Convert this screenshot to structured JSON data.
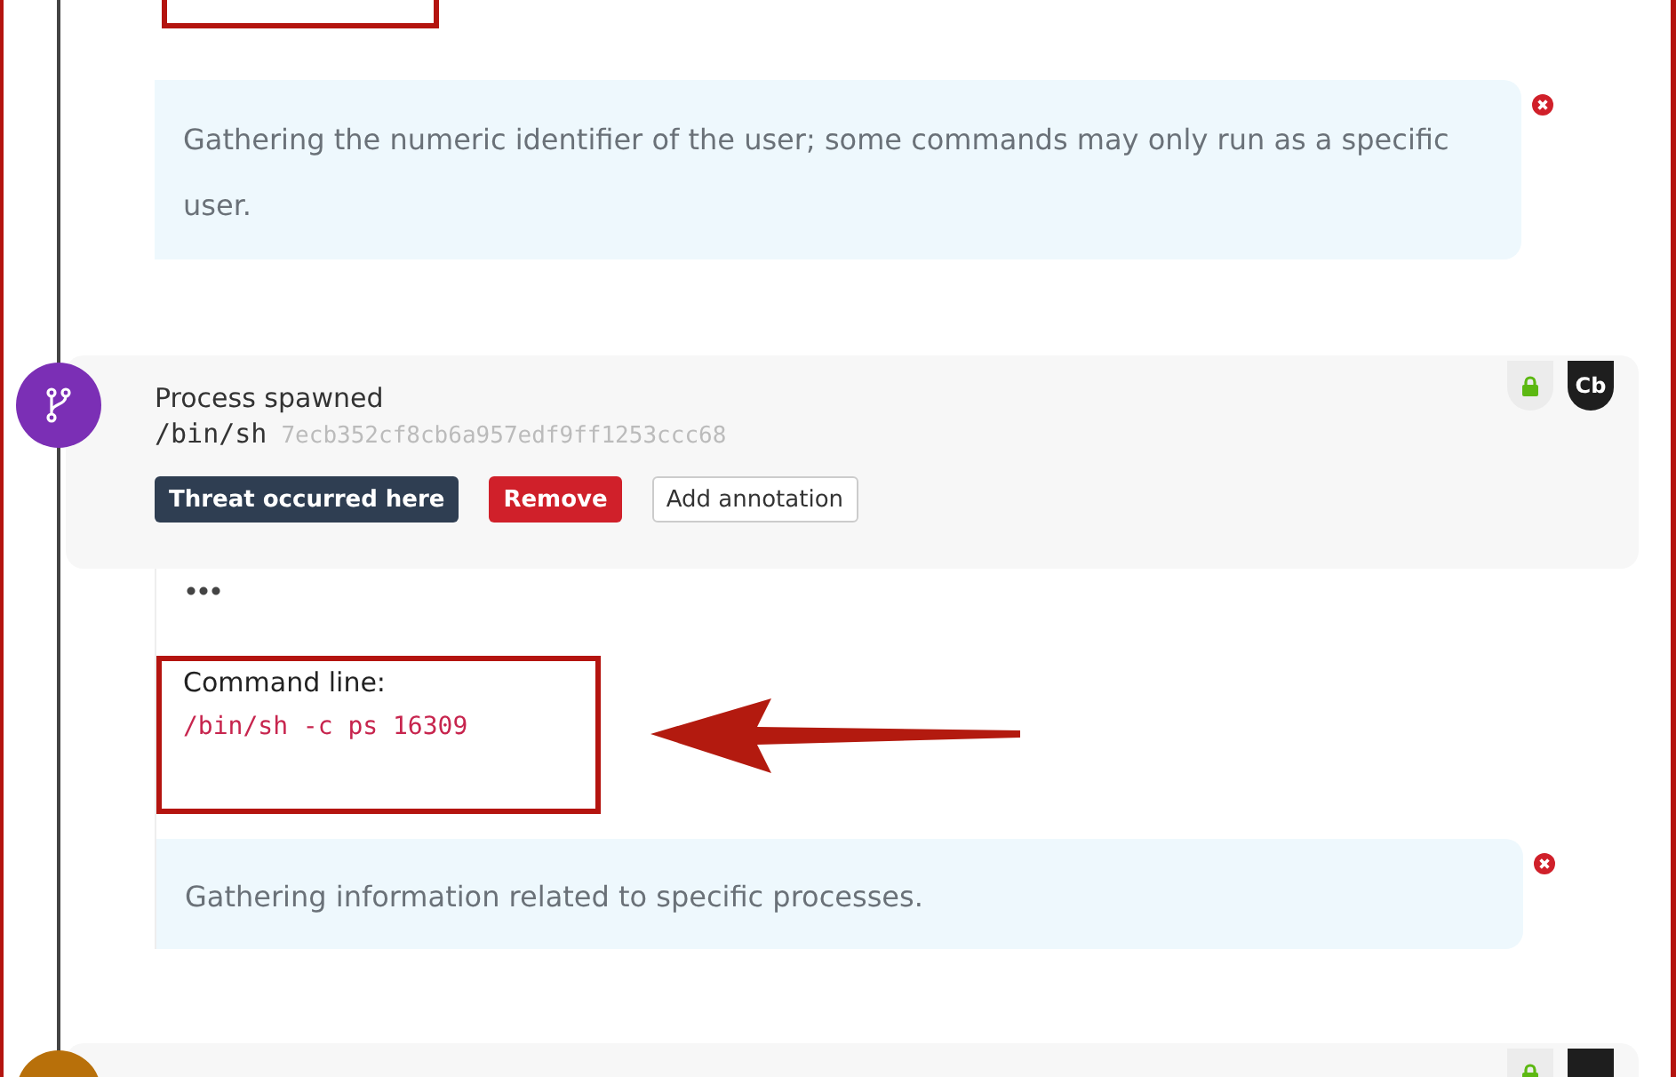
{
  "top_highlight": {
    "shown": true
  },
  "top_note": {
    "text": "Gathering the numeric identifier of the user; some commands may only run as a specific user.",
    "dismissible": true
  },
  "events": [
    {
      "title": "Process spawned",
      "path": "/bin/sh",
      "hash": "7ecb352cf8cb6a957edf9ff1253ccc68",
      "color": "#7b2fb5",
      "actions": [
        {
          "label": "Threat occurred here",
          "kind": "dark"
        },
        {
          "label": "Remove",
          "kind": "danger"
        },
        {
          "label": "Add annotation",
          "kind": "plain"
        }
      ],
      "badges": [
        {
          "kind": "lock"
        },
        {
          "kind": "text",
          "label": "Cb"
        }
      ],
      "command": {
        "label": "Command line:",
        "value": "/bin/sh -c ps 16309",
        "highlighted": true
      },
      "note": {
        "text": "Gathering information related to specific processes.",
        "dismissible": true
      }
    },
    {
      "color": "#b8700a",
      "badges": [
        {
          "kind": "lock"
        },
        {
          "kind": "dark"
        }
      ]
    }
  ]
}
